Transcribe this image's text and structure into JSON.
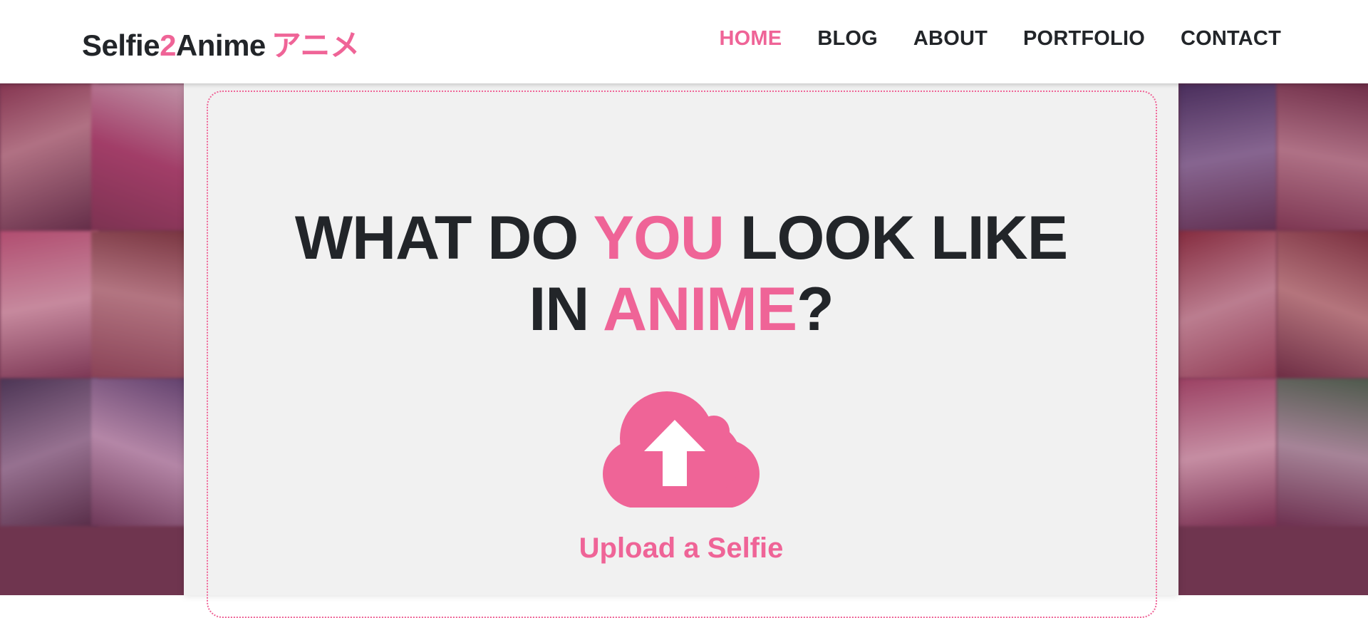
{
  "brand": {
    "part1": "Selfie",
    "part2": "2",
    "part3": "Anime",
    "japanese": "アニメ"
  },
  "nav": {
    "home": "HOME",
    "blog": "BLOG",
    "about": "ABOUT",
    "portfolio": "PORTFOLIO",
    "contact": "CONTACT"
  },
  "hero": {
    "line1_a": "WHAT DO ",
    "line1_b": "YOU",
    "line1_c": " LOOK LIKE",
    "line2_a": "IN ",
    "line2_b": "ANIME",
    "line2_c": "?"
  },
  "upload": {
    "label": "Upload a Selfie",
    "icon": "cloud-upload-icon"
  },
  "colors": {
    "accent": "#ef6497",
    "text": "#222529",
    "panel": "#f1f1f1"
  }
}
